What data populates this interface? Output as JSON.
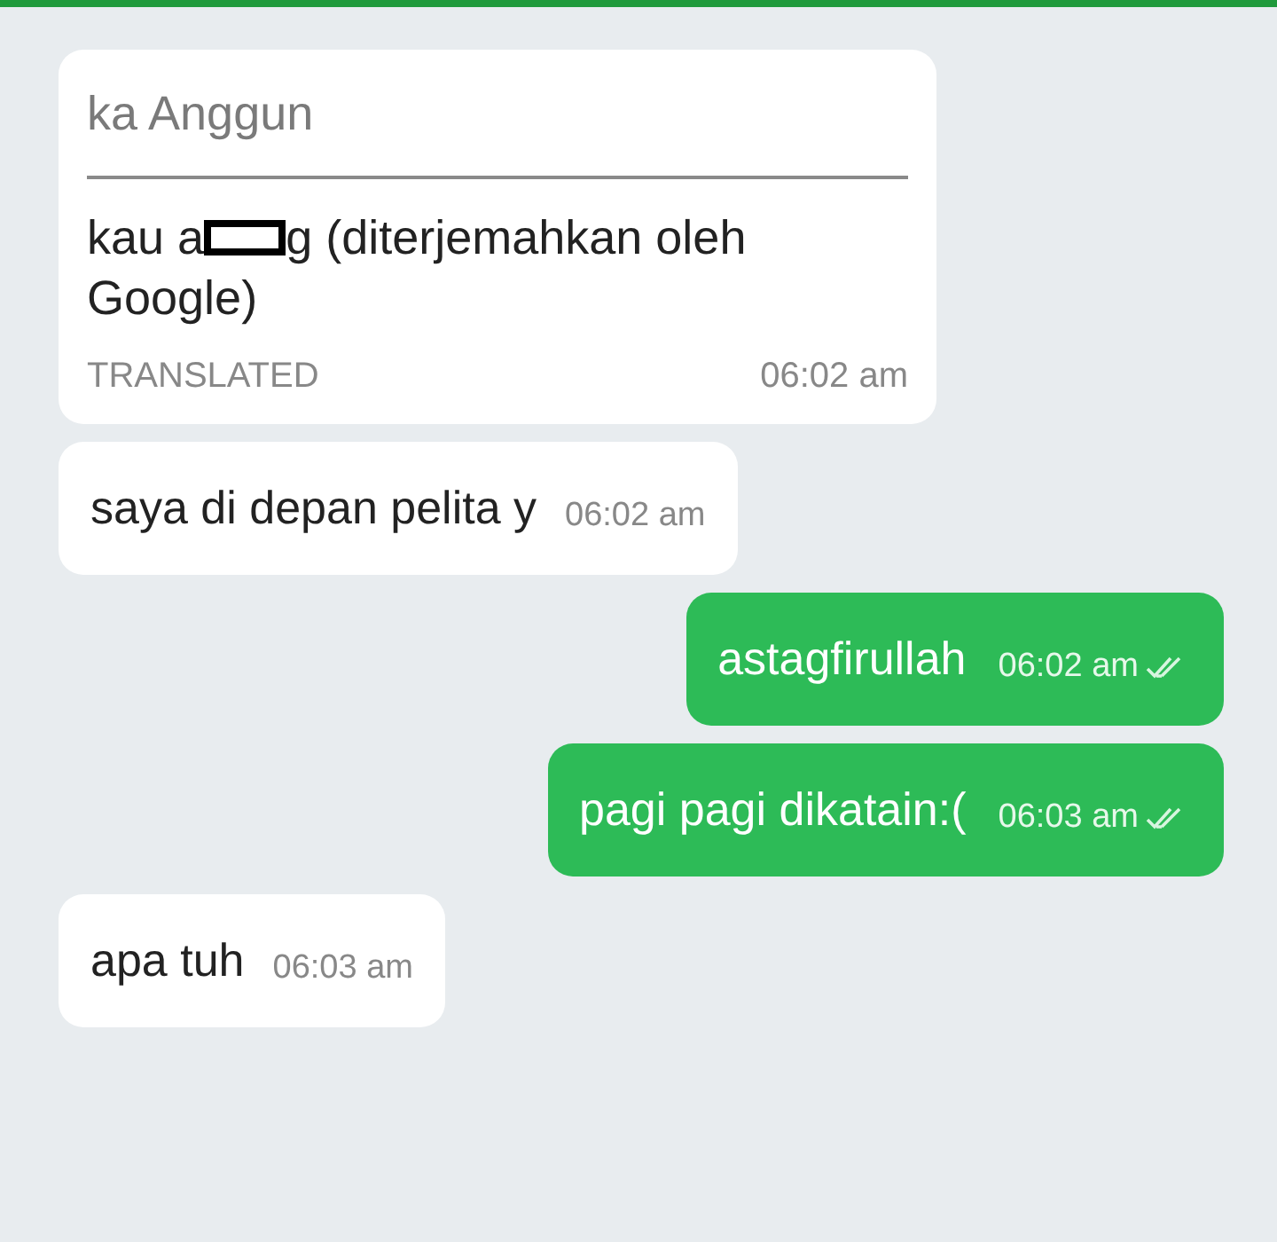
{
  "messages": [
    {
      "kind": "translated",
      "sender": "ka Anggun",
      "text_before_censor": "kau a",
      "text_after_censor": "g (diterjemahkan oleh",
      "text_line_2": "Google)",
      "tag": "TRANSLATED",
      "time": "06:02 am"
    },
    {
      "kind": "incoming",
      "text": "saya di depan pelita y",
      "time": "06:02 am"
    },
    {
      "kind": "outgoing",
      "text": "astagfirullah",
      "time": "06:02 am",
      "read": true
    },
    {
      "kind": "outgoing",
      "text": "pagi pagi dikatain:(",
      "time": "06:03 am",
      "read": true
    },
    {
      "kind": "incoming",
      "text": "apa tuh",
      "time": "06:03 am"
    }
  ]
}
